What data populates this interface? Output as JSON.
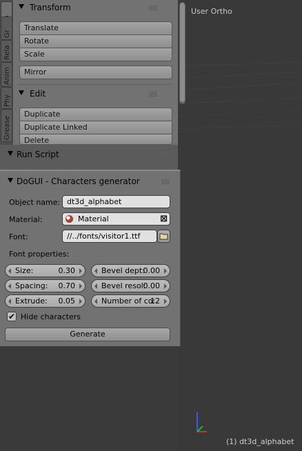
{
  "tabs": [
    "To",
    "Gr",
    "Rela",
    "Anim",
    "Phy",
    "Grease"
  ],
  "toolshelf": {
    "transform": {
      "title": "Transform",
      "buttons": [
        "Translate",
        "Rotate",
        "Scale"
      ],
      "mirror": "Mirror"
    },
    "edit": {
      "title": "Edit",
      "buttons": [
        "Duplicate",
        "Duplicate Linked",
        "Delete"
      ]
    }
  },
  "run_script": {
    "title": "Run Script"
  },
  "dogui": {
    "title": "DoGUI - Characters generator",
    "object_name_label": "Object name:",
    "object_name_value": "dt3d_alphabet",
    "material_label": "Material:",
    "material_value": "Material",
    "font_label": "Font:",
    "font_value": "//../fonts/visitor1.ttf",
    "font_properties_label": "Font properties:",
    "size": {
      "label": "Size:",
      "value": "0.30"
    },
    "spacing": {
      "label": "Spacing:",
      "value": "0.70"
    },
    "extrude": {
      "label": "Extrude:",
      "value": "0.05"
    },
    "bevel_depth": {
      "label": "Bevel dept:",
      "value": "0.00"
    },
    "bevel_resol": {
      "label": "Bevel resol:",
      "value": "0.00"
    },
    "num_chars": {
      "label": "Number of co:",
      "value": "12"
    },
    "hide_characters_label": "Hide characters",
    "hide_characters_checked": true,
    "generate_label": "Generate"
  },
  "viewport": {
    "title": "User Ortho",
    "footer": "(1) dt3d_alphabet"
  },
  "colors": {
    "panel": "#727272",
    "viewport": "#393939",
    "axis_x": "#d03030",
    "axis_y": "#30b030",
    "axis_z": "#3060e0"
  }
}
